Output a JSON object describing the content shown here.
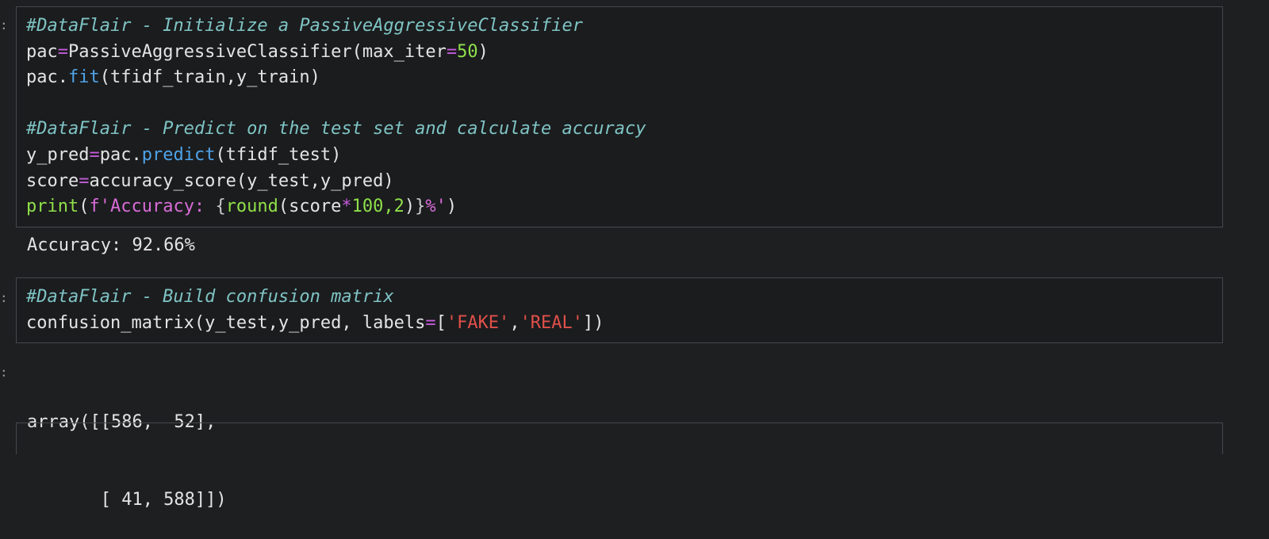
{
  "cell1": {
    "line1_comment": "#DataFlair - Initialize a PassiveAggressiveClassifier",
    "line2": {
      "var": "pac",
      "eq": "=",
      "cls": "PassiveAggressiveClassifier(max_iter",
      "eq2": "=",
      "num": "50",
      "close": ")"
    },
    "line3": {
      "obj": "pac.",
      "method": "fit",
      "args": "(tfidf_train,y_train)"
    },
    "line5_comment": "#DataFlair - Predict on the test set and calculate accuracy",
    "line6": {
      "var": "y_pred",
      "eq": "=",
      "obj": "pac.",
      "method": "predict",
      "args": "(tfidf_test)"
    },
    "line7": {
      "var": "score",
      "eq": "=",
      "call": "accuracy_score(y_test,y_pred)"
    },
    "line8": {
      "fn": "print",
      "open": "(",
      "fstr1": "f'Accuracy: ",
      "brace_open": "{",
      "round_fn": "round",
      "round_args1": "(score",
      "mul": "*",
      "num": "100,2",
      "round_close": ")",
      "brace_close": "}",
      "fstr2": "%'",
      "close": ")"
    }
  },
  "output1": "Accuracy: 92.66%",
  "cell2": {
    "line1_comment": "#DataFlair - Build confusion matrix",
    "line2": {
      "call": "confusion_matrix(y_test,y_pred, labels",
      "eq": "=",
      "open": "[",
      "s1": "'FAKE'",
      "comma": ",",
      "s2": "'REAL'",
      "close": "])"
    }
  },
  "output2": {
    "line1": "array([[586,  52],",
    "line2": "       [ 41, 588]])"
  },
  "gutter_mark": ":"
}
